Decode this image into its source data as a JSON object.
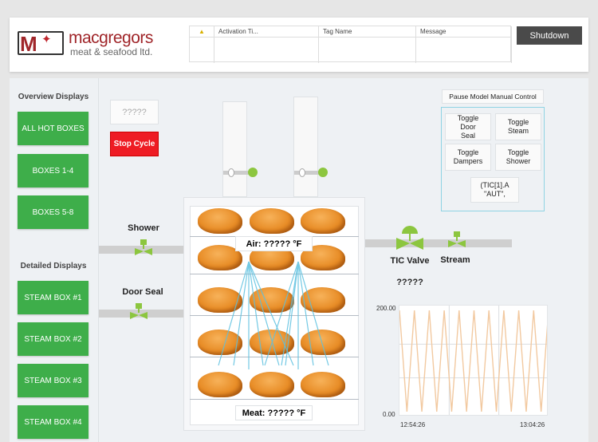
{
  "header": {
    "logo": {
      "name": "macgregors",
      "subtitle": "meat & seafood ltd.",
      "letter": "M"
    },
    "alarm_table": {
      "columns": [
        "",
        "Activation Ti...",
        "Tag Name",
        "Message"
      ],
      "warning_icon": "warning-triangle-icon"
    },
    "shutdown_label": "Shutdown"
  },
  "sidebar": {
    "overview_heading": "Overview Displays",
    "overview_items": [
      "ALL HOT BOXES",
      "BOXES 1-4",
      "BOXES 5-8"
    ],
    "detailed_heading": "Detailed Displays",
    "detailed_items": [
      "STEAM BOX #1",
      "STEAM BOX #2",
      "STEAM BOX #3",
      "STEAM BOX #4"
    ]
  },
  "controls": {
    "status_value": "?????",
    "stop_cycle_label": "Stop Cycle"
  },
  "oven": {
    "air_label": "Air: ????? °F",
    "meat_label": "Meat: ????? °F"
  },
  "valves": {
    "shower_label": "Shower",
    "door_seal_label": "Door Seal",
    "tic_valve_label": "TIC Valve",
    "tic_valve_value": "?????",
    "stream_label": "Stream",
    "color": "#8cc63f"
  },
  "manual": {
    "pause_label": "Pause Model Manual Control",
    "toggles": [
      "Toggle Door Seal",
      "Toggle Steam",
      "Toggle Dampers",
      "Toggle Shower"
    ],
    "tic_button_label": "(TIC[1].A \"AUT\","
  },
  "colors": {
    "green": "#3eae4a",
    "red": "#ee1c24",
    "brand": "#a0262a",
    "trend": "#f2c9a0"
  },
  "chart_data": {
    "type": "line",
    "ylim": [
      0,
      200
    ],
    "ytick_labels": [
      "200.00",
      "0.00"
    ],
    "xtick_labels": [
      "12:54:26",
      "13:04:26"
    ],
    "grid": true,
    "series": [
      {
        "x": [
          "12:54:26",
          "12:54:56",
          "12:55:26",
          "12:55:56",
          "12:56:26",
          "12:56:56",
          "12:57:26",
          "12:57:56",
          "12:58:26",
          "12:58:56",
          "12:59:26",
          "12:59:56",
          "13:00:26",
          "13:00:56",
          "13:01:26",
          "13:01:56",
          "13:02:26",
          "13:02:56",
          "13:03:26",
          "13:03:56",
          "13:04:26"
        ],
        "values": [
          200,
          0,
          200,
          0,
          200,
          0,
          200,
          0,
          200,
          0,
          200,
          0,
          200,
          0,
          200,
          0,
          200,
          0,
          200,
          0,
          200
        ]
      }
    ]
  }
}
